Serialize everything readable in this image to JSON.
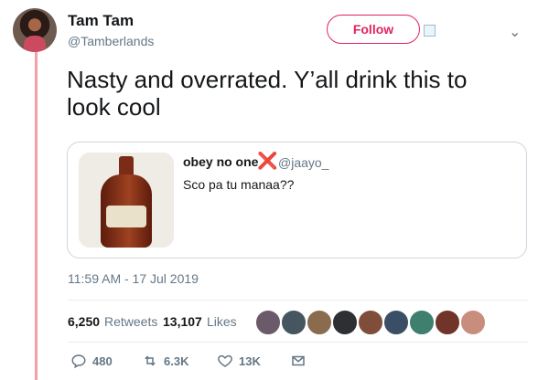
{
  "user": {
    "name": "Tam Tam",
    "handle": "@Tamberlands"
  },
  "header": {
    "follow_label": "Follow"
  },
  "tweet": {
    "text": "Nasty and overrated. Y’all drink this to look cool"
  },
  "quote": {
    "name": "obey no one",
    "name_emoji": "❌",
    "handle": "@jaayo_",
    "text": "Sco pa tu manaa??"
  },
  "meta": {
    "timestamp": "11:59 AM - 17 Jul 2019"
  },
  "stats": {
    "retweets": "6,250",
    "retweets_label": "Retweets",
    "likes": "13,107",
    "likes_label": "Likes"
  },
  "actions": {
    "replies": "480",
    "retweets": "6.3K",
    "likes": "13K"
  },
  "colors": {
    "accent": "#e0245e",
    "thread": "#f4a0a6",
    "muted": "#657786"
  }
}
